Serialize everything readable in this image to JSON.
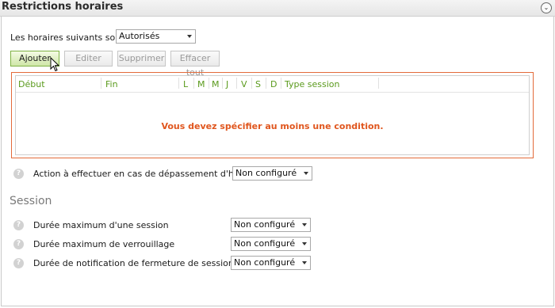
{
  "header": {
    "title": "Restrictions horaires",
    "collapse_icon": "chevron-down-icon"
  },
  "schedule": {
    "label": "Les horaires suivants sont",
    "mode_value": "Autorisés"
  },
  "toolbar": {
    "add": "Ajouter",
    "edit": "Editer",
    "delete": "Supprimer",
    "clear_all": "Effacer tout"
  },
  "grid": {
    "columns": [
      "Début",
      "Fin",
      "L",
      "M",
      "M",
      "J",
      "V",
      "S",
      "D",
      "Type session"
    ],
    "empty_message": "Vous devez spécifier au moins une condition.",
    "colors": {
      "border": "#e36a3a",
      "header_text": "#5a9a1c",
      "message": "#e0561e"
    }
  },
  "overtime": {
    "label": "Action à effectuer en cas de dépassement d'horaire",
    "value": "Non configuré"
  },
  "session": {
    "title": "Session",
    "rows": [
      {
        "label": "Durée maximum d'une session",
        "value": "Non configuré"
      },
      {
        "label": "Durée maximum de verrouillage",
        "value": "Non configuré"
      },
      {
        "label": "Durée de notification de fermeture de session",
        "value": "Non configuré"
      }
    ]
  },
  "help_glyph": "?"
}
